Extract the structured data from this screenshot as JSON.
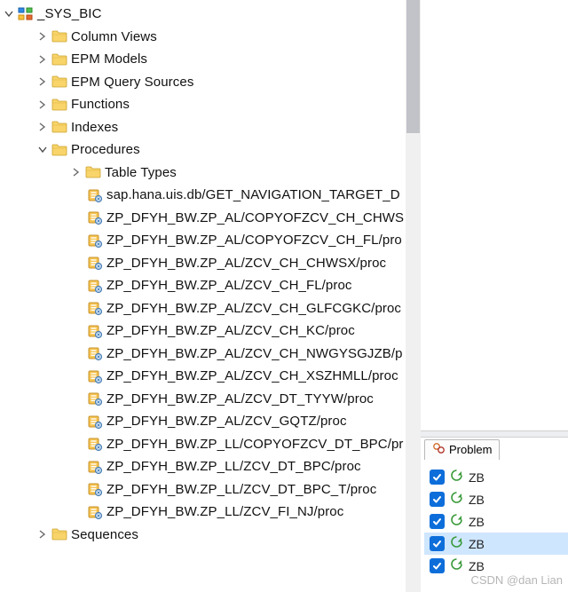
{
  "root": {
    "label": "_SYS_BIC"
  },
  "folders": [
    {
      "label": "Column Views",
      "expanded": false
    },
    {
      "label": "EPM Models",
      "expanded": false
    },
    {
      "label": "EPM Query Sources",
      "expanded": false
    },
    {
      "label": "Functions",
      "expanded": false
    },
    {
      "label": "Indexes",
      "expanded": false
    },
    {
      "label": "Procedures",
      "expanded": true
    },
    {
      "label": "Sequences",
      "expanded": false,
      "partial": true
    }
  ],
  "procedures_children": {
    "folder": {
      "label": "Table Types"
    },
    "items": [
      "sap.hana.uis.db/GET_NAVIGATION_TARGET_D",
      "ZP_DFYH_BW.ZP_AL/COPYOFZCV_CH_CHWS",
      "ZP_DFYH_BW.ZP_AL/COPYOFZCV_CH_FL/pro",
      "ZP_DFYH_BW.ZP_AL/ZCV_CH_CHWSX/proc",
      "ZP_DFYH_BW.ZP_AL/ZCV_CH_FL/proc",
      "ZP_DFYH_BW.ZP_AL/ZCV_CH_GLFCGKC/proc",
      "ZP_DFYH_BW.ZP_AL/ZCV_CH_KC/proc",
      "ZP_DFYH_BW.ZP_AL/ZCV_CH_NWGYSGJZB/p",
      "ZP_DFYH_BW.ZP_AL/ZCV_CH_XSZHMLL/proc",
      "ZP_DFYH_BW.ZP_AL/ZCV_DT_TYYW/proc",
      "ZP_DFYH_BW.ZP_AL/ZCV_GQTZ/proc",
      "ZP_DFYH_BW.ZP_LL/COPYOFZCV_DT_BPC/pr",
      "ZP_DFYH_BW.ZP_LL/ZCV_DT_BPC/proc",
      "ZP_DFYH_BW.ZP_LL/ZCV_DT_BPC_T/proc",
      "ZP_DFYH_BW.ZP_LL/ZCV_FI_NJ/proc"
    ]
  },
  "problems_tab": {
    "label": "Problem"
  },
  "checklist": [
    {
      "label": "ZB",
      "selected": false
    },
    {
      "label": "ZB",
      "selected": false
    },
    {
      "label": "ZB",
      "selected": false
    },
    {
      "label": "ZB",
      "selected": true
    },
    {
      "label": "ZB",
      "selected": false
    }
  ],
  "watermark": "CSDN @dan Lian"
}
